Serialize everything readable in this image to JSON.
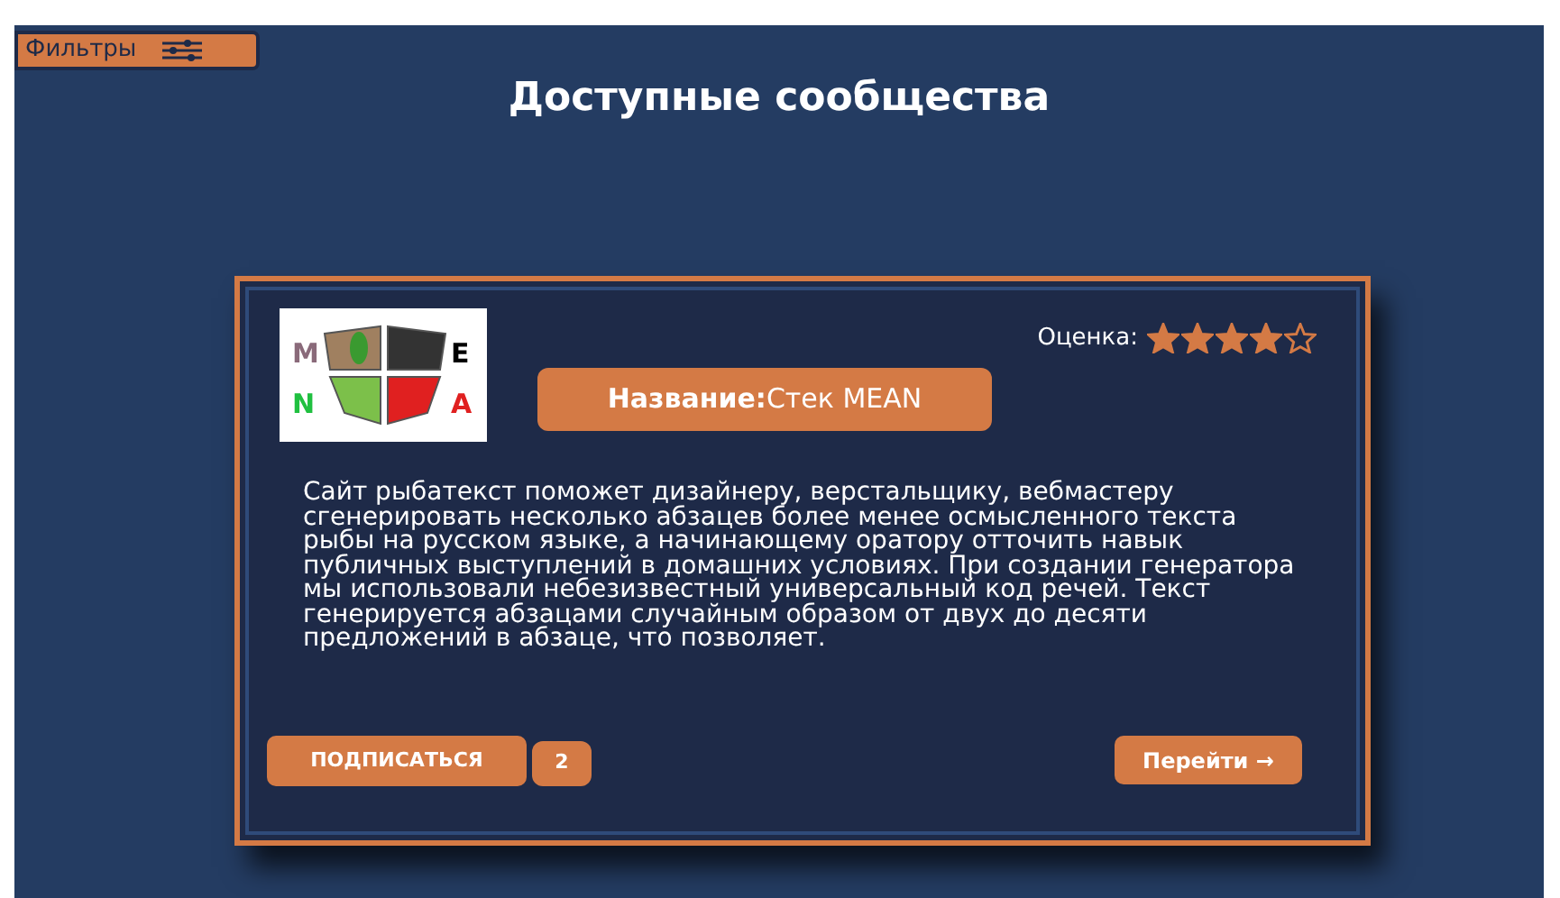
{
  "filter_button": {
    "label": "Фильтры"
  },
  "title": "Доступные сообщества",
  "community": {
    "logo_letters": [
      "M",
      "E",
      "N",
      "A"
    ],
    "rating_label": "Оценка:",
    "stars": 4,
    "name_label": "Название:",
    "name": "Стек MEAN",
    "description": "Сайт рыбатекст поможет дизайнеру, верстальщику, вебмастеру сгенерировать несколько абзацев более менее осмысленного текста рыбы на русском языке, а начинающему оратору отточить навык публичных выступлений в домашних условиях. При создании генератора мы использовали небезизвестный универсальный код речей. Текст генерируется абзацами случайным образом от двух до десяти предложений в абзаце, что позволяет.",
    "subscribe_label": "ПОДПИСАТЬСЯ",
    "subscribers": "2",
    "go_label": "Перейти →"
  }
}
